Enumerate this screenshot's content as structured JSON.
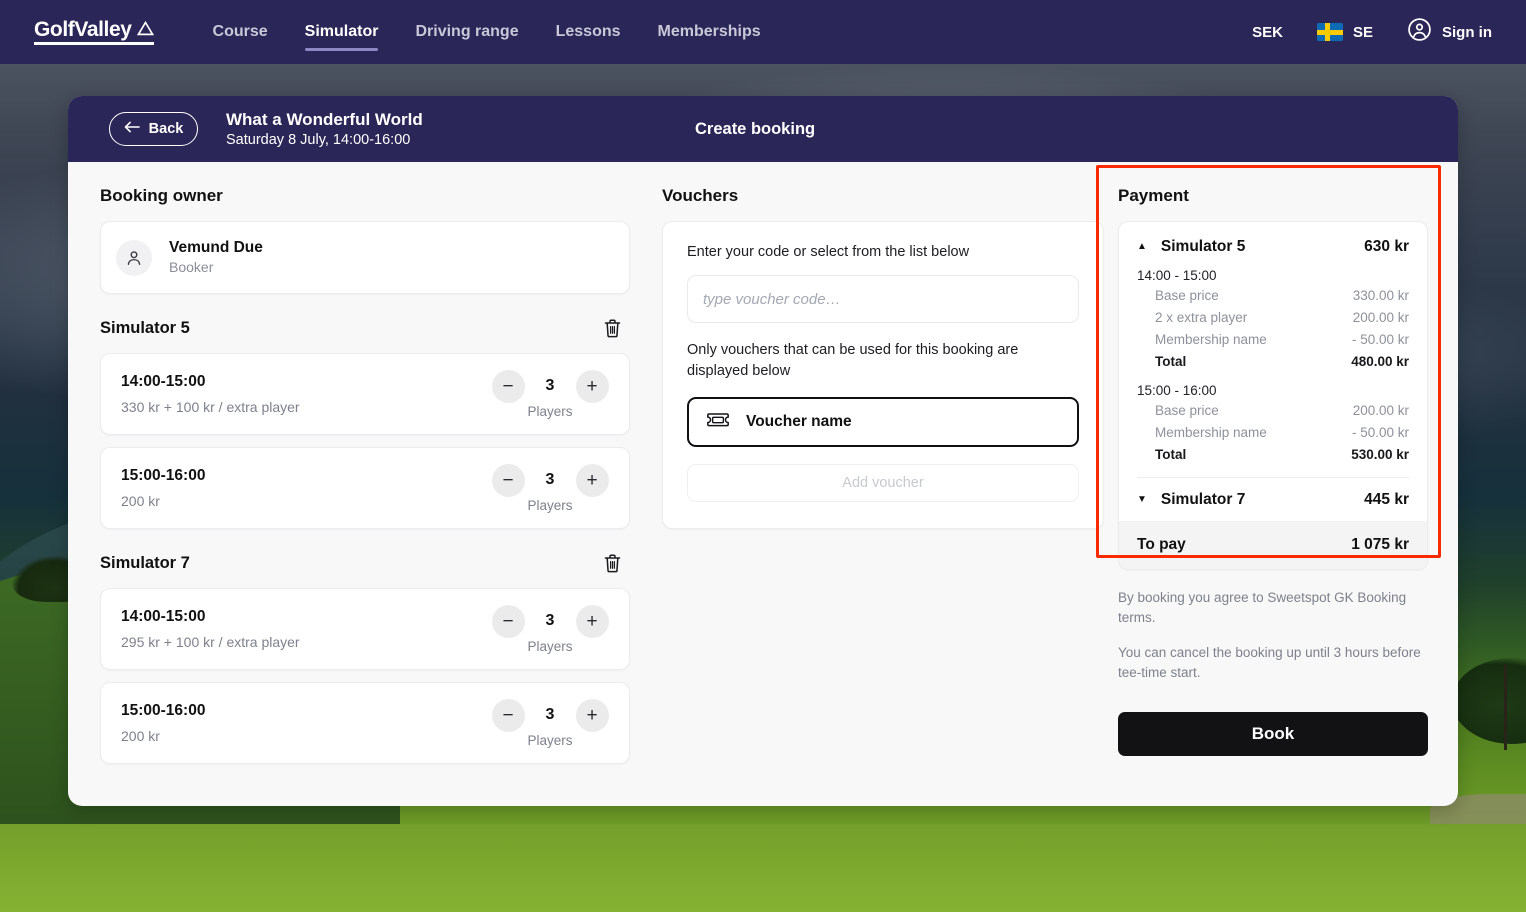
{
  "nav": {
    "logo": "GolfValley",
    "logo_mark_icon": "mountain-icon",
    "links": [
      {
        "label": "Course",
        "active": false
      },
      {
        "label": "Simulator",
        "active": true
      },
      {
        "label": "Driving range",
        "active": false
      },
      {
        "label": "Lessons",
        "active": false
      },
      {
        "label": "Memberships",
        "active": false
      }
    ],
    "currency": "SEK",
    "language": "SE",
    "language_flag_icon": "sweden-flag-icon",
    "sign_in": "Sign in",
    "sign_in_icon": "account-circle-icon",
    "bg_color": "#2a2657"
  },
  "sheet": {
    "back_label": "Back",
    "back_icon": "arrow-left-icon",
    "title": "What a Wonderful World",
    "subtitle": "Saturday 8 July, 14:00-16:00",
    "center_title": "Create booking"
  },
  "booking_owner": {
    "section_title": "Booking owner",
    "avatar_icon": "person-icon",
    "name": "Vemund Due",
    "role": "Booker"
  },
  "simulators": [
    {
      "name": "Simulator 5",
      "delete_icon": "trash-icon",
      "slots": [
        {
          "time": "14:00-15:00",
          "price": "330 kr + 100 kr / extra player",
          "count": "3",
          "players_label": "Players",
          "minus_icon": "minus-icon",
          "plus_icon": "plus-icon"
        },
        {
          "time": "15:00-16:00",
          "price": "200 kr",
          "count": "3",
          "players_label": "Players",
          "minus_icon": "minus-icon",
          "plus_icon": "plus-icon"
        }
      ]
    },
    {
      "name": "Simulator 7",
      "delete_icon": "trash-icon",
      "slots": [
        {
          "time": "14:00-15:00",
          "price": "295 kr  + 100 kr / extra player",
          "count": "3",
          "players_label": "Players",
          "minus_icon": "minus-icon",
          "plus_icon": "plus-icon"
        },
        {
          "time": "15:00-16:00",
          "price": "200 kr",
          "count": "3",
          "players_label": "Players",
          "minus_icon": "minus-icon",
          "plus_icon": "plus-icon"
        }
      ]
    }
  ],
  "vouchers": {
    "section_title": "Vouchers",
    "label": "Enter your code or select from the list below",
    "input_value": "",
    "input_placeholder": "type voucher code…",
    "note": "Only vouchers that can be used for this booking are displayed below",
    "item_icon": "ticket-icon",
    "item_label": "Voucher name",
    "add_label": "Add voucher"
  },
  "payment": {
    "section_title": "Payment",
    "highlight_color": "#f92a00",
    "groups": [
      {
        "expanded": true,
        "caret_icon": "caret-up-icon",
        "name": "Simulator 5",
        "amount": "630 kr",
        "slots": [
          {
            "time": "14:00 - 15:00",
            "rows": [
              {
                "label": "Base price",
                "value": "330.00 kr",
                "is_total": false
              },
              {
                "label": "2 x extra player",
                "value": "200.00 kr",
                "is_total": false
              },
              {
                "label": "Membership name",
                "value": "- 50.00 kr",
                "is_total": false
              },
              {
                "label": "Total",
                "value": "480.00 kr",
                "is_total": true
              }
            ]
          },
          {
            "time": "15:00 - 16:00",
            "rows": [
              {
                "label": "Base price",
                "value": "200.00 kr",
                "is_total": false
              },
              {
                "label": "Membership name",
                "value": "- 50.00 kr",
                "is_total": false
              },
              {
                "label": "Total",
                "value": "530.00 kr",
                "is_total": true
              }
            ]
          }
        ]
      },
      {
        "expanded": false,
        "caret_icon": "caret-down-icon",
        "name": "Simulator 7",
        "amount": "445 kr",
        "slots": []
      }
    ],
    "to_pay_label": "To pay",
    "to_pay_value": "1 075 kr",
    "terms_1": "By booking you agree to Sweetspot GK Booking terms.",
    "terms_2": "You can cancel the booking up until 3 hours before tee-time start.",
    "book_label": "Book"
  }
}
